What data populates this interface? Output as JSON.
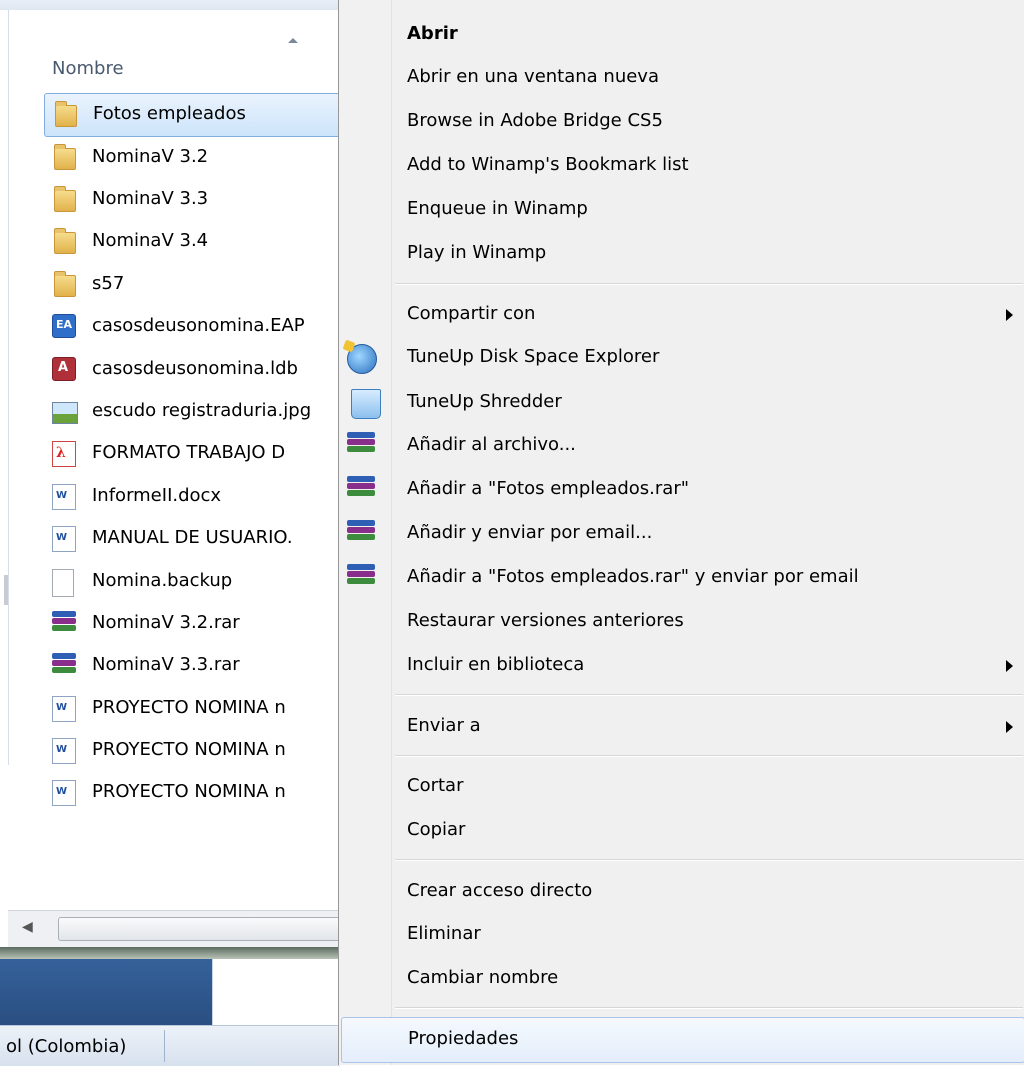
{
  "explorer": {
    "column_header": "Nombre",
    "files": [
      {
        "name": "Fotos empleados",
        "icon": "folder-icon",
        "selected": true
      },
      {
        "name": "NominaV 3.2",
        "icon": "folder-icon"
      },
      {
        "name": "NominaV 3.3",
        "icon": "folder-icon"
      },
      {
        "name": "NominaV 3.4",
        "icon": "folder-icon"
      },
      {
        "name": "s57",
        "icon": "folder-icon"
      },
      {
        "name": "casosdeusonomina.EAP",
        "icon": "ea-project-icon"
      },
      {
        "name": "casosdeusonomina.ldb",
        "icon": "access-lock-icon"
      },
      {
        "name": "escudo registraduria.jpg",
        "icon": "image-file-icon"
      },
      {
        "name": "FORMATO TRABAJO D",
        "icon": "pdf-icon"
      },
      {
        "name": "InformeII.docx",
        "icon": "word-doc-icon"
      },
      {
        "name": "MANUAL DE USUARIO.",
        "icon": "word-doc-icon"
      },
      {
        "name": "Nomina.backup",
        "icon": "generic-file-icon"
      },
      {
        "name": "NominaV 3.2.rar",
        "icon": "winrar-archive-icon"
      },
      {
        "name": "NominaV 3.3.rar",
        "icon": "winrar-archive-icon"
      },
      {
        "name": "PROYECTO NOMINA n",
        "icon": "word-doc-icon"
      },
      {
        "name": "PROYECTO NOMINA n",
        "icon": "word-doc-icon"
      },
      {
        "name": "PROYECTO NOMINA n",
        "icon": "word-doc-icon"
      }
    ],
    "status_language": "ol (Colombia)"
  },
  "context_menu": {
    "items": [
      {
        "label": "Abrir",
        "bold": true
      },
      {
        "label": "Abrir en una ventana nueva"
      },
      {
        "label": "Browse in Adobe Bridge CS5"
      },
      {
        "label": "Add to Winamp's Bookmark list"
      },
      {
        "label": "Enqueue in Winamp"
      },
      {
        "label": "Play in Winamp"
      },
      {
        "label": "Compartir con",
        "submenu": true
      },
      {
        "label": "TuneUp Disk Space Explorer",
        "icon": "tuneup-disk-space-icon"
      },
      {
        "label": "TuneUp Shredder",
        "icon": "tuneup-shredder-icon"
      },
      {
        "label": "Añadir al archivo...",
        "icon": "winrar-icon"
      },
      {
        "label": "Añadir a \"Fotos empleados.rar\"",
        "icon": "winrar-icon"
      },
      {
        "label": "Añadir y enviar por email...",
        "icon": "winrar-icon"
      },
      {
        "label": "Añadir a \"Fotos empleados.rar\" y enviar por email",
        "icon": "winrar-icon"
      },
      {
        "label": "Restaurar versiones anteriores"
      },
      {
        "label": "Incluir en biblioteca",
        "submenu": true
      },
      {
        "label": "Enviar a",
        "submenu": true
      },
      {
        "label": "Cortar"
      },
      {
        "label": "Copiar"
      },
      {
        "label": "Crear acceso directo"
      },
      {
        "label": "Eliminar"
      },
      {
        "label": "Cambiar nombre"
      },
      {
        "label": "Propiedades",
        "hovered": true
      }
    ]
  }
}
